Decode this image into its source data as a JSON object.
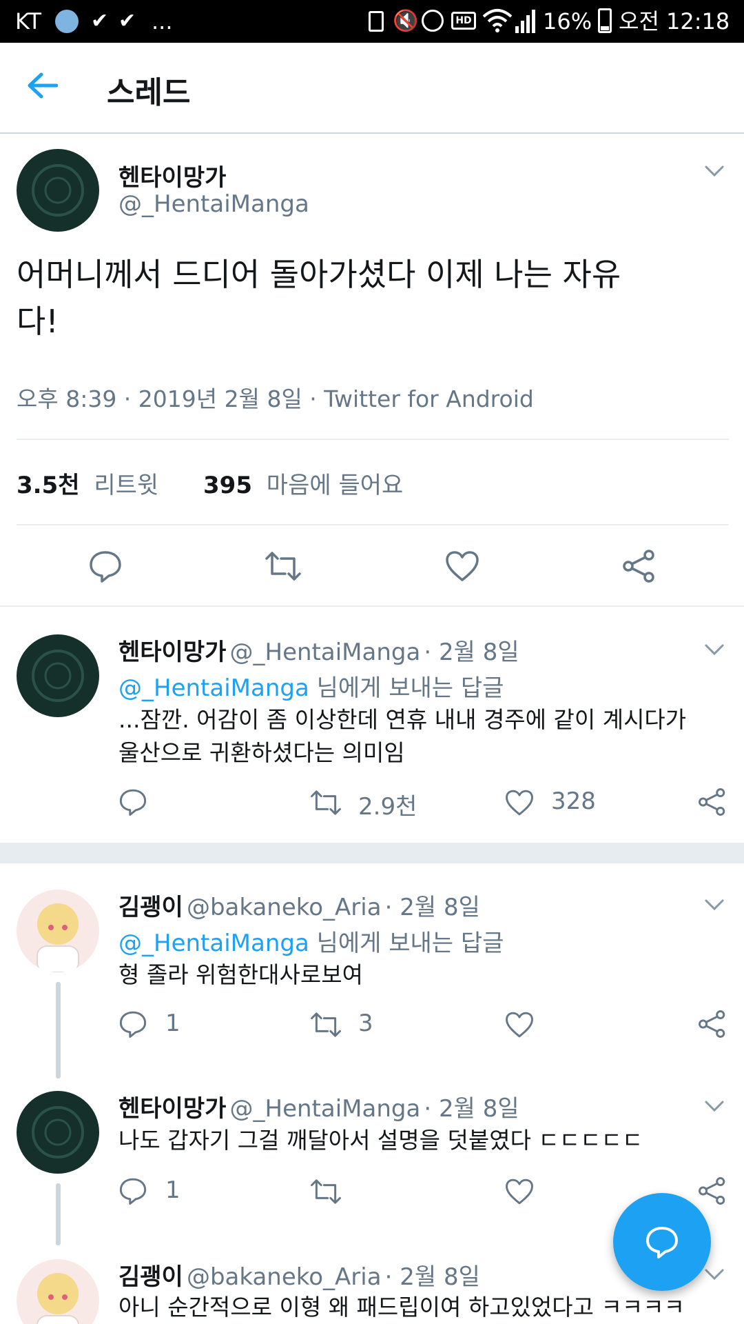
{
  "status_bar": {
    "carrier": "KT",
    "more": "...",
    "battery": "16%",
    "time": "오전 12:18"
  },
  "header": {
    "title": "스레드"
  },
  "main_tweet": {
    "name": "헨타이망가",
    "handle": "@_HentaiManga",
    "text_line1": "어머니께서 드디어 돌아가셨다 이제 나는 자유",
    "text_line2": "다!",
    "meta": "오후 8:39 · 2019년 2월 8일 · Twitter for Android",
    "retweets_count": "3.5천",
    "retweets_label": "리트윗",
    "likes_count": "395",
    "likes_label": "마음에 들어요"
  },
  "replies": [
    {
      "name": "헨타이망가",
      "handle": "@_HentaiManga",
      "date": "· 2월 8일",
      "reply_to_handle": "@_HentaiManga",
      "reply_to_suffix": "님에게 보내는 답글",
      "text_line1": "...잠깐. 어감이 좀 이상한데 연휴 내내 경주에 같이 계시다가",
      "text_line2": "울산으로 귀환하셨다는 의미임",
      "retweet_count": "2.9천",
      "like_count": "328"
    },
    {
      "name": "김괭이",
      "handle": "@bakaneko_Aria",
      "date": "· 2월 8일",
      "reply_to_handle": "@_HentaiManga",
      "reply_to_suffix": "님에게 보내는 답글",
      "text_line1": "형 졸라 위험한대사로보여",
      "reply_count": "1",
      "retweet_count": "3"
    },
    {
      "name": "헨타이망가",
      "handle": "@_HentaiManga",
      "date": "· 2월 8일",
      "text_line1": "나도 갑자기 그걸 깨달아서 설명을 덧붙였다 ㄷㄷㄷㄷㄷ",
      "reply_count": "1"
    },
    {
      "name": "김괭이",
      "handle": "@bakaneko_Aria",
      "date": "· 2월 8일",
      "text_line1": "아니 순간적으로 이형 왜 패드립이여 하고있었다고 ㅋㅋㅋㅋ"
    }
  ],
  "colors": {
    "accent": "#1da1f2",
    "text": "#14171a",
    "secondary": "#657786",
    "divider": "#e6ecf0"
  }
}
